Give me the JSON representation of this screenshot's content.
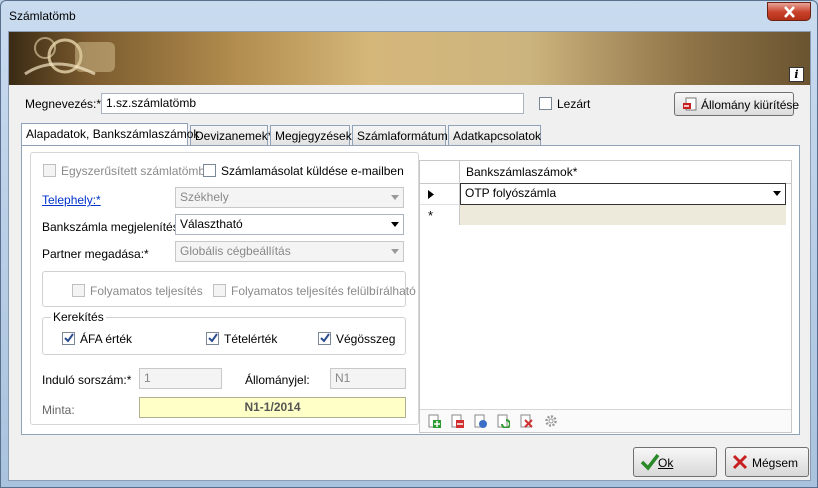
{
  "window": {
    "title": "Számlatömb"
  },
  "form": {
    "name_label": "Megnevezés:*",
    "name_value": "1.sz.számlatömb",
    "lezart_label": "Lezárt",
    "clear_button": "Állomány kiürítése"
  },
  "tabs": [
    "Alapadatok, Bankszámlaszámok",
    "Devizanemek*",
    "Megjegyzések",
    "Számlaformátum",
    "Adatkapcsolatok"
  ],
  "left": {
    "simplified_label": "Egyszerűsített számlatömb",
    "email_copy_label": "Számlamásolat küldése e-mailben",
    "site_label": "Telephely:*",
    "site_value": "Székhely",
    "bank_display_label": "Bankszámla megjelenítés:*",
    "bank_display_value": "Választható",
    "partner_label": "Partner megadása:*",
    "partner_value": "Globális cégbeállítás",
    "continuous_label": "Folyamatos teljesítés",
    "continuous_override_label": "Folyamatos teljesítés felülbírálható",
    "rounding_title": "Kerekítés",
    "afa_label": "ÁFA érték",
    "item_label": "Tételérték",
    "total_label": "Végösszeg",
    "start_label": "Induló sorszám:*",
    "start_value": "1",
    "file_mark_label": "Állományjel:",
    "file_mark_value": "N1",
    "sample_label": "Minta:",
    "sample_value": "N1-1/2014"
  },
  "grid": {
    "column": "Bankszámlaszámok*",
    "rows": [
      "OTP folyószámla"
    ],
    "new_row_marker": "*"
  },
  "footer": {
    "ok": "Ok",
    "cancel": "Mégsem"
  },
  "colors": {
    "accent_link": "#0033cc",
    "sample_bg": "#ffffc8",
    "check_blue": "#2a4d8f"
  }
}
